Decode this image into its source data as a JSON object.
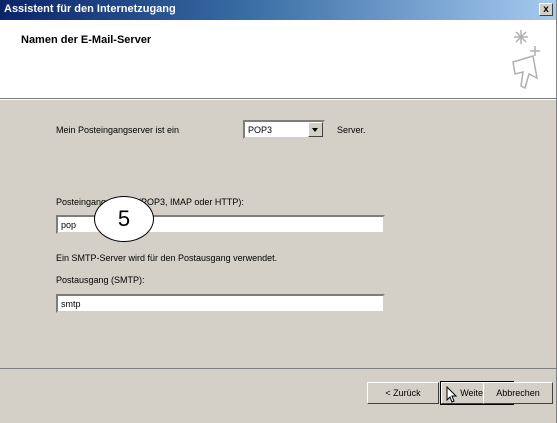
{
  "window": {
    "title": "Assistent für den Internetzugang",
    "close_glyph": "x"
  },
  "header": {
    "title": "Namen der E-Mail-Server",
    "icon": "wizard-sparkle-icon"
  },
  "incoming_type": {
    "label": "Mein Posteingangserver ist ein",
    "value": "POP3",
    "suffix": "Server."
  },
  "incoming_server": {
    "label": "Posteingangsserver (POP3, IMAP oder HTTP):",
    "value": "pop"
  },
  "smtp_note": "Ein SMTP-Server wird für den Postausgang verwendet.",
  "outgoing_server": {
    "label": "Postausgang (SMTP):",
    "value": "smtp"
  },
  "step_badge": "5",
  "buttons": {
    "back": "< Zurück",
    "next": "Weiter >",
    "cancel": "Abbrechen"
  }
}
